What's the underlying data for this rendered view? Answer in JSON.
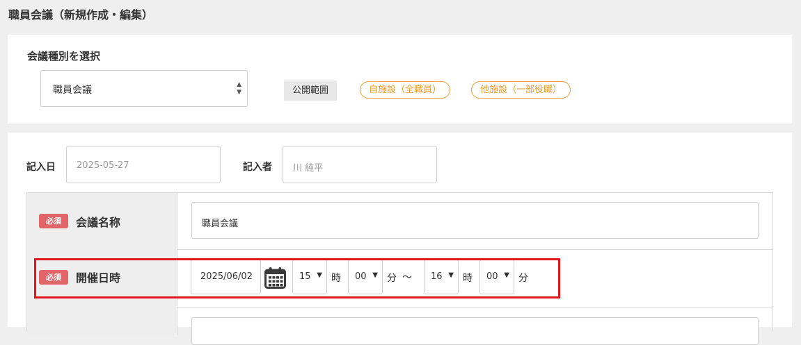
{
  "page_title": "職員会議（新規作成・編集）",
  "meeting_type": {
    "section_label": "会議種別を選択",
    "selected": "職員会議",
    "scope_label": "公開範囲",
    "scope_tags": [
      "自施設（全職員）",
      "他施設（一部役職）"
    ],
    "accent_color": "#ef9a2e"
  },
  "form": {
    "entry_date_label": "記入日",
    "entry_date_value": "2025-05-27",
    "author_label": "記入者",
    "author_value": "川 純平",
    "required_badge": "必須",
    "required_color": "#e06468",
    "rows": [
      {
        "title": "会議名称",
        "value": "職員会議"
      },
      {
        "title": "開催日時"
      }
    ],
    "datetime": {
      "date": "2025/06/02",
      "start_hour": "15",
      "start_minute": "00",
      "end_hour": "16",
      "end_minute": "00",
      "hour_unit": "時",
      "minute_unit": "分",
      "range_separator": "〜"
    }
  },
  "highlight_color": "#e3161d"
}
